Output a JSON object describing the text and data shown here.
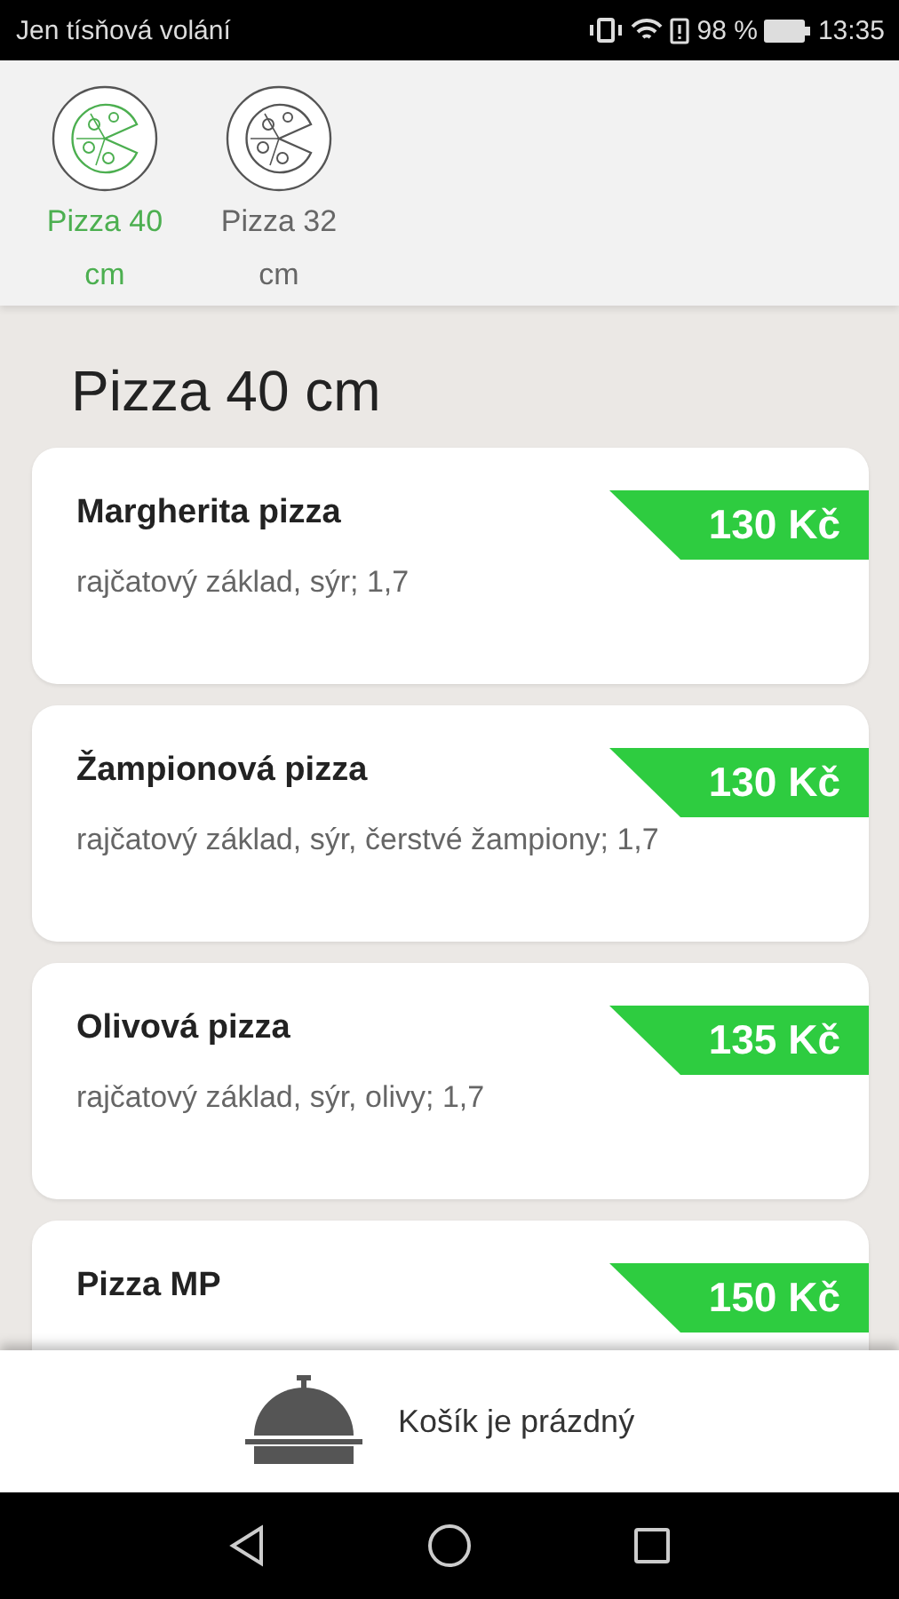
{
  "status_bar": {
    "carrier": "Jen tísňová volání",
    "battery_percent": "98 %",
    "time": "13:35"
  },
  "categories": [
    {
      "label": "Pizza 40 cm",
      "selected": true
    },
    {
      "label": "Pizza 32 cm",
      "selected": false
    }
  ],
  "section_title": "Pizza 40 cm",
  "items": [
    {
      "name": "Margherita pizza",
      "description": "rajčatový základ, sýr; 1,7",
      "price": "130 Kč"
    },
    {
      "name": "Žampionová pizza",
      "description": "rajčatový základ, sýr, čerstvé žampiony; 1,7",
      "price": "130 Kč"
    },
    {
      "name": "Olivová pizza",
      "description": "rajčatový základ, sýr, olivy; 1,7",
      "price": "135 Kč"
    },
    {
      "name": "Pizza MP",
      "price": "150 Kč"
    }
  ],
  "cart": {
    "label": "Košík je prázdný"
  }
}
